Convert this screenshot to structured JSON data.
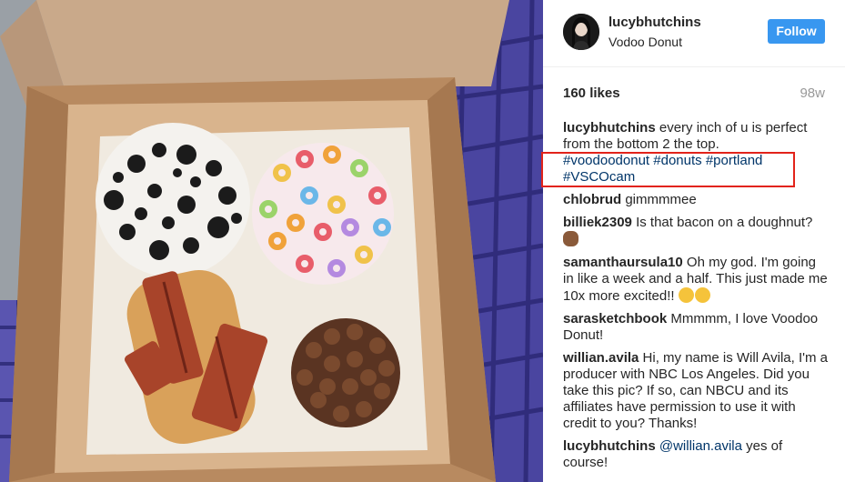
{
  "post": {
    "username": "lucybhutchins",
    "location": "Vodoo Donut",
    "follow_label": "Follow",
    "likes": "160 likes",
    "age": "98w"
  },
  "caption": {
    "username": "lucybhutchins",
    "text": "every inch of u is perfect from the bottom 2 the top.",
    "hashtags": [
      "#voodoodonut",
      "#donuts",
      "#portland",
      "#VSCOcam"
    ]
  },
  "comments": [
    {
      "username": "chlobrud",
      "text": "gimmmmee"
    },
    {
      "username": "billiek2309",
      "text": "Is that bacon on a doughnut?",
      "emoji": "see-no-evil-monkey"
    },
    {
      "username": "samanthaursula10",
      "text": "Oh my god. I'm going in like a week and a half. This just made me 10x more excited!!",
      "emoji": "heart-eyes, tongue-face"
    },
    {
      "username": "sarasketchbook",
      "text": "Mmmmm, I love Voodoo Donut!"
    },
    {
      "username": "willian.avila",
      "text": "Hi, my name is Will Avila, I'm a producer with NBC Los Angeles. Did you take this pic? If so, can NBCU and its affiliates have permission to use it with credit to you? Thanks!"
    },
    {
      "username": "lucybhutchins",
      "mention": "@willian.avila",
      "text": "yes of course!"
    }
  ],
  "colors": {
    "follow_button": "#3897f0",
    "hashtag": "#003569",
    "highlight_border": "#e2231a",
    "muted": "#999999"
  },
  "photo": {
    "subject": "box of four donuts (Oreo, Froot Loops, bacon maple, cocoa puffs)"
  }
}
